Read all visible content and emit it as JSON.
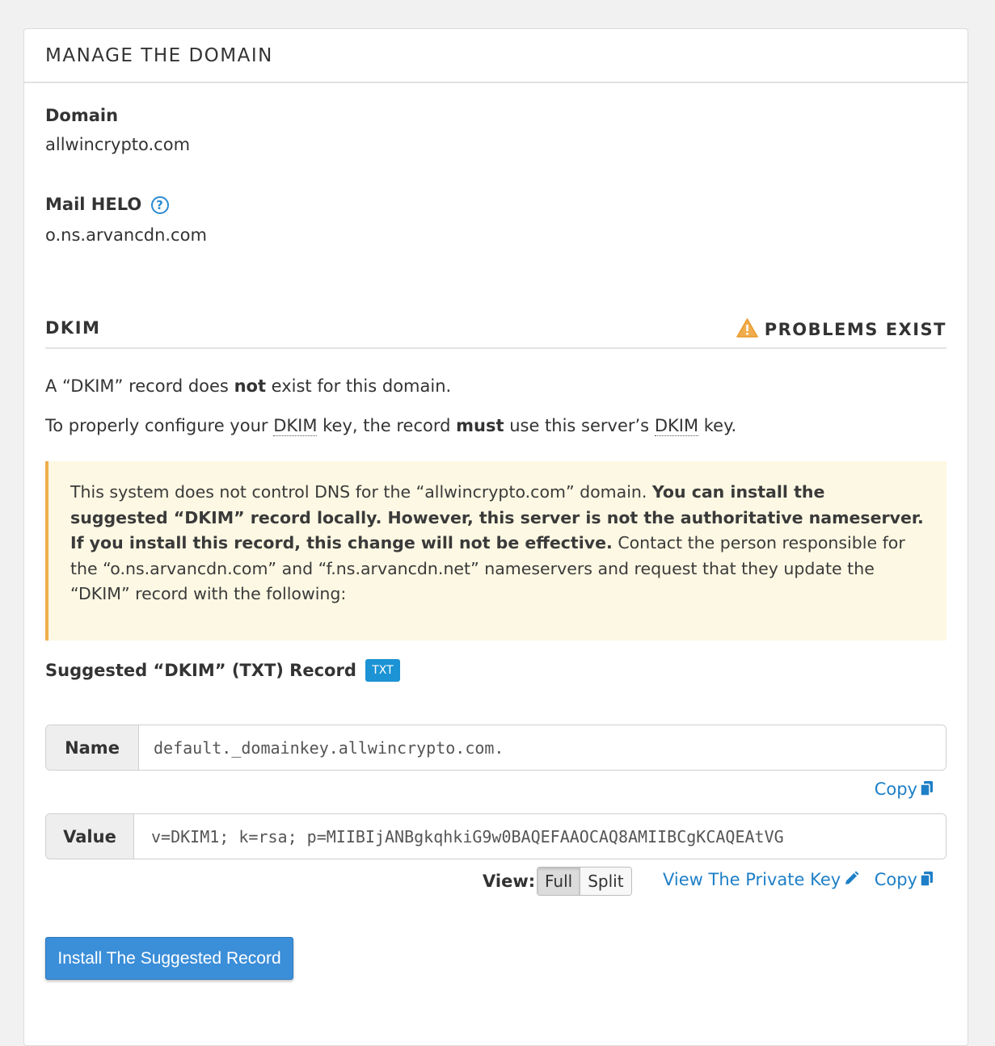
{
  "panel": {
    "title": "MANAGE THE DOMAIN"
  },
  "domain": {
    "label": "Domain",
    "value": "allwincrypto.com"
  },
  "mail_helo": {
    "label": "Mail HELO",
    "help_icon": "question-circle-icon",
    "value": "o.ns.arvancdn.com"
  },
  "dkim": {
    "title": "DKIM",
    "status": "PROBLEMS EXIST",
    "status_icon": "warning-triangle-icon",
    "line1": {
      "a": "A “DKIM” record does ",
      "b": "not",
      "c": " exist for this domain."
    },
    "line2": {
      "a": "To properly configure your ",
      "abbr1": "DKIM",
      "b": " key, the record ",
      "strong": "must",
      "c": " use this server’s ",
      "abbr2": "DKIM",
      "d": " key."
    },
    "alert": {
      "part1": "This system does not control DNS for the “allwincrypto.com” domain. ",
      "bold": "You can install the suggested “DKIM” record locally. However, this server is not the authoritative nameserver. If you install this record, this change will not be effective.",
      "part2": " Contact the person responsible for the “o.ns.arvancdn.com” and “f.ns.arvancdn.net” nameservers and request that they update the “DKIM” record with the following:"
    },
    "suggested_label": "Suggested “DKIM” (TXT) Record",
    "badge": "TXT",
    "name_label": "Name",
    "name_value": "default._domainkey.allwincrypto.com.",
    "copy_label": "Copy",
    "value_label": "Value",
    "value_value": "v=DKIM1; k=rsa; p=MIIBIjANBgkqhkiG9w0BAQEFAAOCAQ8AMIIBCgKCAQEAtVG",
    "view_label": "View:",
    "view_full": "Full",
    "view_split": "Split",
    "view_private_key": "View The Private Key",
    "install_button": "Install The Suggested Record"
  },
  "colors": {
    "accent": "#1e7fc7",
    "button": "#3b8ed8",
    "warning": "#f0ad4e",
    "alert_bg": "#fcf8e3",
    "badge": "#1b93d4"
  }
}
